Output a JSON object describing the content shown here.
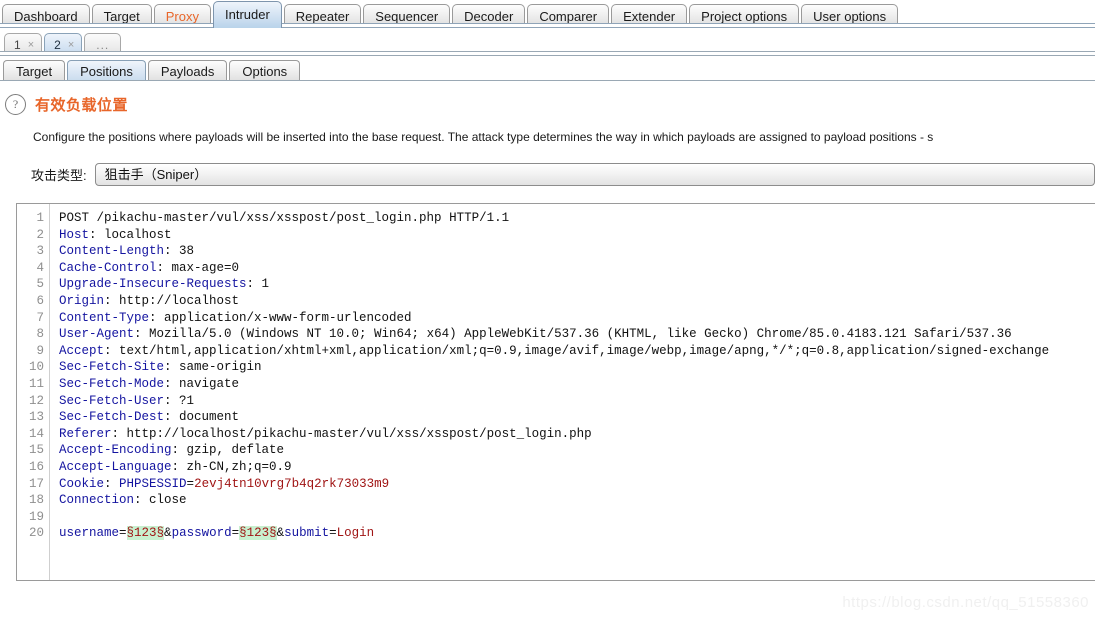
{
  "main_tabs": [
    {
      "label": "Dashboard",
      "selected": false,
      "accent": false
    },
    {
      "label": "Target",
      "selected": false,
      "accent": false
    },
    {
      "label": "Proxy",
      "selected": false,
      "accent": true
    },
    {
      "label": "Intruder",
      "selected": true,
      "accent": false
    },
    {
      "label": "Repeater",
      "selected": false,
      "accent": false
    },
    {
      "label": "Sequencer",
      "selected": false,
      "accent": false
    },
    {
      "label": "Decoder",
      "selected": false,
      "accent": false
    },
    {
      "label": "Comparer",
      "selected": false,
      "accent": false
    },
    {
      "label": "Extender",
      "selected": false,
      "accent": false
    },
    {
      "label": "Project options",
      "selected": false,
      "accent": false
    },
    {
      "label": "User options",
      "selected": false,
      "accent": false
    }
  ],
  "attack_tabs": [
    {
      "label": "1",
      "close": "×",
      "selected": false
    },
    {
      "label": "2",
      "close": "×",
      "selected": true
    }
  ],
  "attack_tab_more": "...",
  "sub_tabs": [
    {
      "label": "Target",
      "selected": false
    },
    {
      "label": "Positions",
      "selected": true
    },
    {
      "label": "Payloads",
      "selected": false
    },
    {
      "label": "Options",
      "selected": false
    }
  ],
  "panel": {
    "help_icon": "?",
    "title": "有效负载位置",
    "description": "Configure the positions where payloads will be inserted into the base request. The attack type determines the way in which payloads are assigned to payload positions - s",
    "attack_type_label": "攻击类型:",
    "attack_type_value": "狙击手（Sniper）"
  },
  "request": {
    "line_numbers": [
      "1",
      "2",
      "3",
      "4",
      "5",
      "6",
      "7",
      "8",
      "9",
      "10",
      "11",
      "12",
      "13",
      "14",
      "15",
      "16",
      "17",
      "18",
      "19",
      "20"
    ],
    "lines": [
      {
        "n": 1,
        "segs": [
          {
            "t": "POST /pikachu-master/vul/xss/xsspost/post_login.php HTTP/1.1",
            "c": "hv"
          }
        ]
      },
      {
        "n": 2,
        "segs": [
          {
            "t": "Host",
            "c": "hk"
          },
          {
            "t": ": localhost",
            "c": "hv"
          }
        ]
      },
      {
        "n": 3,
        "segs": [
          {
            "t": "Content-Length",
            "c": "hk"
          },
          {
            "t": ": 38",
            "c": "hv"
          }
        ]
      },
      {
        "n": 4,
        "segs": [
          {
            "t": "Cache-Control",
            "c": "hk"
          },
          {
            "t": ": max-age=0",
            "c": "hv"
          }
        ]
      },
      {
        "n": 5,
        "segs": [
          {
            "t": "Upgrade-Insecure-Requests",
            "c": "hk"
          },
          {
            "t": ": 1",
            "c": "hv"
          }
        ]
      },
      {
        "n": 6,
        "segs": [
          {
            "t": "Origin",
            "c": "hk"
          },
          {
            "t": ": http://localhost",
            "c": "hv"
          }
        ]
      },
      {
        "n": 7,
        "segs": [
          {
            "t": "Content-Type",
            "c": "hk"
          },
          {
            "t": ": application/x-www-form-urlencoded",
            "c": "hv"
          }
        ]
      },
      {
        "n": 8,
        "segs": [
          {
            "t": "User-Agent",
            "c": "hk"
          },
          {
            "t": ": Mozilla/5.0 (Windows NT 10.0; Win64; x64) AppleWebKit/537.36 (KHTML, like Gecko) Chrome/85.0.4183.121 Safari/537.36",
            "c": "hv"
          }
        ]
      },
      {
        "n": 9,
        "segs": [
          {
            "t": "Accept",
            "c": "hk"
          },
          {
            "t": ": text/html,application/xhtml+xml,application/xml;q=0.9,image/avif,image/webp,image/apng,*/*;q=0.8,application/signed-exchange",
            "c": "hv"
          }
        ]
      },
      {
        "n": 10,
        "segs": [
          {
            "t": "Sec-Fetch-Site",
            "c": "hk"
          },
          {
            "t": ": same-origin",
            "c": "hv"
          }
        ]
      },
      {
        "n": 11,
        "segs": [
          {
            "t": "Sec-Fetch-Mode",
            "c": "hk"
          },
          {
            "t": ": navigate",
            "c": "hv"
          }
        ]
      },
      {
        "n": 12,
        "segs": [
          {
            "t": "Sec-Fetch-User",
            "c": "hk"
          },
          {
            "t": ": ?1",
            "c": "hv"
          }
        ]
      },
      {
        "n": 13,
        "segs": [
          {
            "t": "Sec-Fetch-Dest",
            "c": "hk"
          },
          {
            "t": ": document",
            "c": "hv"
          }
        ]
      },
      {
        "n": 14,
        "segs": [
          {
            "t": "Referer",
            "c": "hk"
          },
          {
            "t": ": http://localhost/pikachu-master/vul/xss/xsspost/post_login.php",
            "c": "hv"
          }
        ]
      },
      {
        "n": 15,
        "segs": [
          {
            "t": "Accept-Encoding",
            "c": "hk"
          },
          {
            "t": ": gzip, deflate",
            "c": "hv"
          }
        ]
      },
      {
        "n": 16,
        "segs": [
          {
            "t": "Accept-Language",
            "c": "hk"
          },
          {
            "t": ": zh-CN,zh;q=0.9",
            "c": "hv"
          }
        ]
      },
      {
        "n": 17,
        "segs": [
          {
            "t": "Cookie",
            "c": "hk"
          },
          {
            "t": ": ",
            "c": "hv"
          },
          {
            "t": "PHPSESSID",
            "c": "ck"
          },
          {
            "t": "=",
            "c": "hv"
          },
          {
            "t": "2evj4tn10vrg7b4q2rk73033m9",
            "c": "cv"
          }
        ]
      },
      {
        "n": 18,
        "segs": [
          {
            "t": "Connection",
            "c": "hk"
          },
          {
            "t": ": close",
            "c": "hv"
          }
        ]
      },
      {
        "n": 19,
        "segs": [
          {
            "t": "",
            "c": "hv"
          }
        ]
      },
      {
        "n": 20,
        "segs": [
          {
            "t": "username",
            "c": "body-key"
          },
          {
            "t": "=",
            "c": "body-txt"
          },
          {
            "t": "§123§",
            "c": "mark"
          },
          {
            "t": "&",
            "c": "body-txt"
          },
          {
            "t": "password",
            "c": "body-key"
          },
          {
            "t": "=",
            "c": "body-txt"
          },
          {
            "t": "§123§",
            "c": "mark"
          },
          {
            "t": "&",
            "c": "body-txt"
          },
          {
            "t": "submit",
            "c": "body-key"
          },
          {
            "t": "=",
            "c": "body-txt"
          },
          {
            "t": "Login",
            "c": "body-val"
          }
        ]
      }
    ]
  },
  "watermark": "https://blog.csdn.net/qq_51558360",
  "colors": {
    "accent_orange": "#e8662a",
    "header_key_blue": "#1414a0",
    "value_red": "#a01515",
    "marker_highlight": "#c8f0cf",
    "selected_tab_blue": "#c3d9ec"
  }
}
